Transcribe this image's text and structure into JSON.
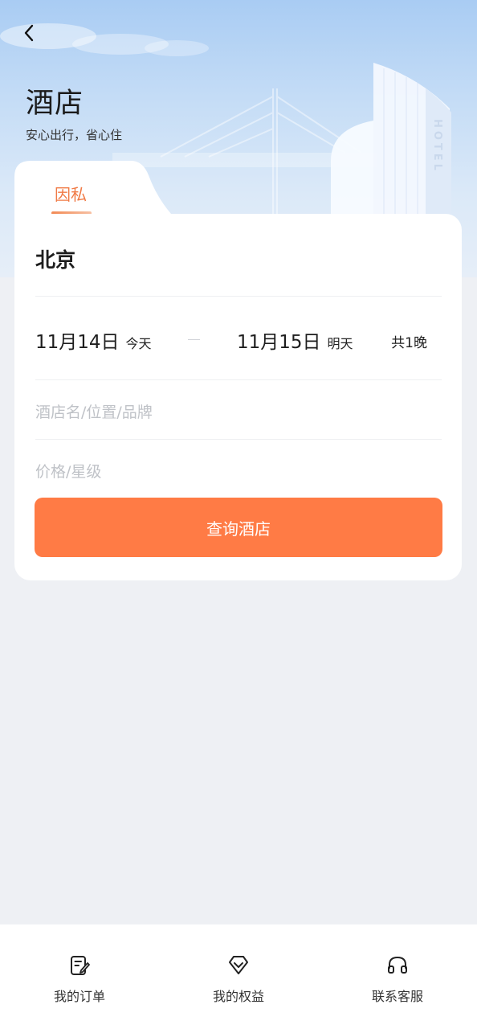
{
  "header": {
    "title": "酒店",
    "subtitle": "安心出行，省心住",
    "back_icon": "chevron-left-icon",
    "hotel_sign": "HOTEL"
  },
  "tabs": [
    {
      "label": "因私",
      "active": true
    }
  ],
  "search": {
    "city": "北京",
    "checkin": {
      "date": "11月14日",
      "tag": "今天"
    },
    "checkout": {
      "date": "11月15日",
      "tag": "明天"
    },
    "nights": "共1晚",
    "keyword_placeholder": "酒店名/位置/品牌",
    "price_placeholder": "价格/星级",
    "submit_label": "查询酒店"
  },
  "bottom_nav": [
    {
      "label": "我的订单",
      "icon": "order-icon"
    },
    {
      "label": "我的权益",
      "icon": "benefits-icon"
    },
    {
      "label": "联系客服",
      "icon": "headset-icon"
    }
  ],
  "colors": {
    "accent": "#ff7b45",
    "tab_active": "#f07a45",
    "background": "#eef0f4",
    "hero_top": "#a9ccf3"
  }
}
